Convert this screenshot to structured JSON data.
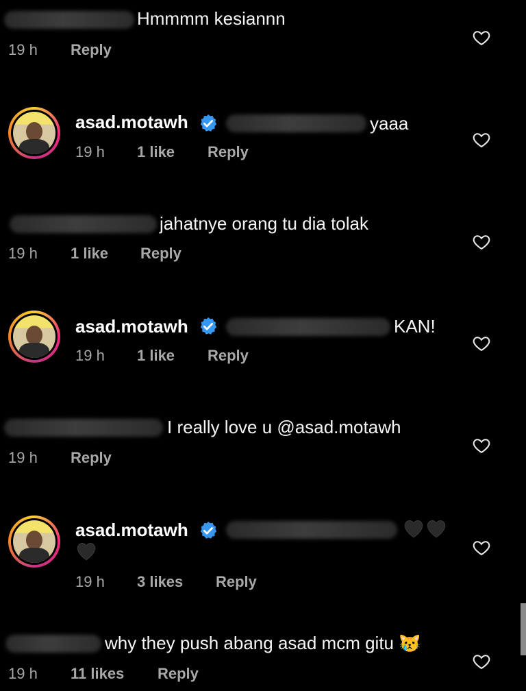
{
  "comments": [
    {
      "id": "c1",
      "text": "Hmmmm kesiannn",
      "time": "19 h",
      "likes": "",
      "reply": "Reply"
    },
    {
      "id": "r1",
      "username": "asad.motawh",
      "text": "yaaa",
      "time": "19 h",
      "likes": "1 like",
      "reply": "Reply"
    },
    {
      "id": "c2",
      "text": "jahatnye orang tu dia tolak",
      "time": "19 h",
      "likes": "1 like",
      "reply": "Reply"
    },
    {
      "id": "r2",
      "username": "asad.motawh",
      "text": "KAN!",
      "time": "19 h",
      "likes": "1 like",
      "reply": "Reply"
    },
    {
      "id": "c3",
      "text": "I really love u @asad.motawh",
      "time": "19 h",
      "likes": "",
      "reply": "Reply"
    },
    {
      "id": "r3",
      "username": "asad.motawh",
      "text": "",
      "time": "19 h",
      "likes": "3 likes",
      "reply": "Reply"
    },
    {
      "id": "c4",
      "text": "why they push abang asad mcm gitu 😿",
      "time": "19 h",
      "likes": "11 likes",
      "reply": "Reply"
    }
  ],
  "icons": {
    "like": "heart-outline-icon",
    "verified": "verified-badge-icon",
    "black_heart": "black-heart-emoji"
  },
  "colors": {
    "background": "#000000",
    "verified": "#3797f0",
    "meta": "#a8a8a8"
  }
}
